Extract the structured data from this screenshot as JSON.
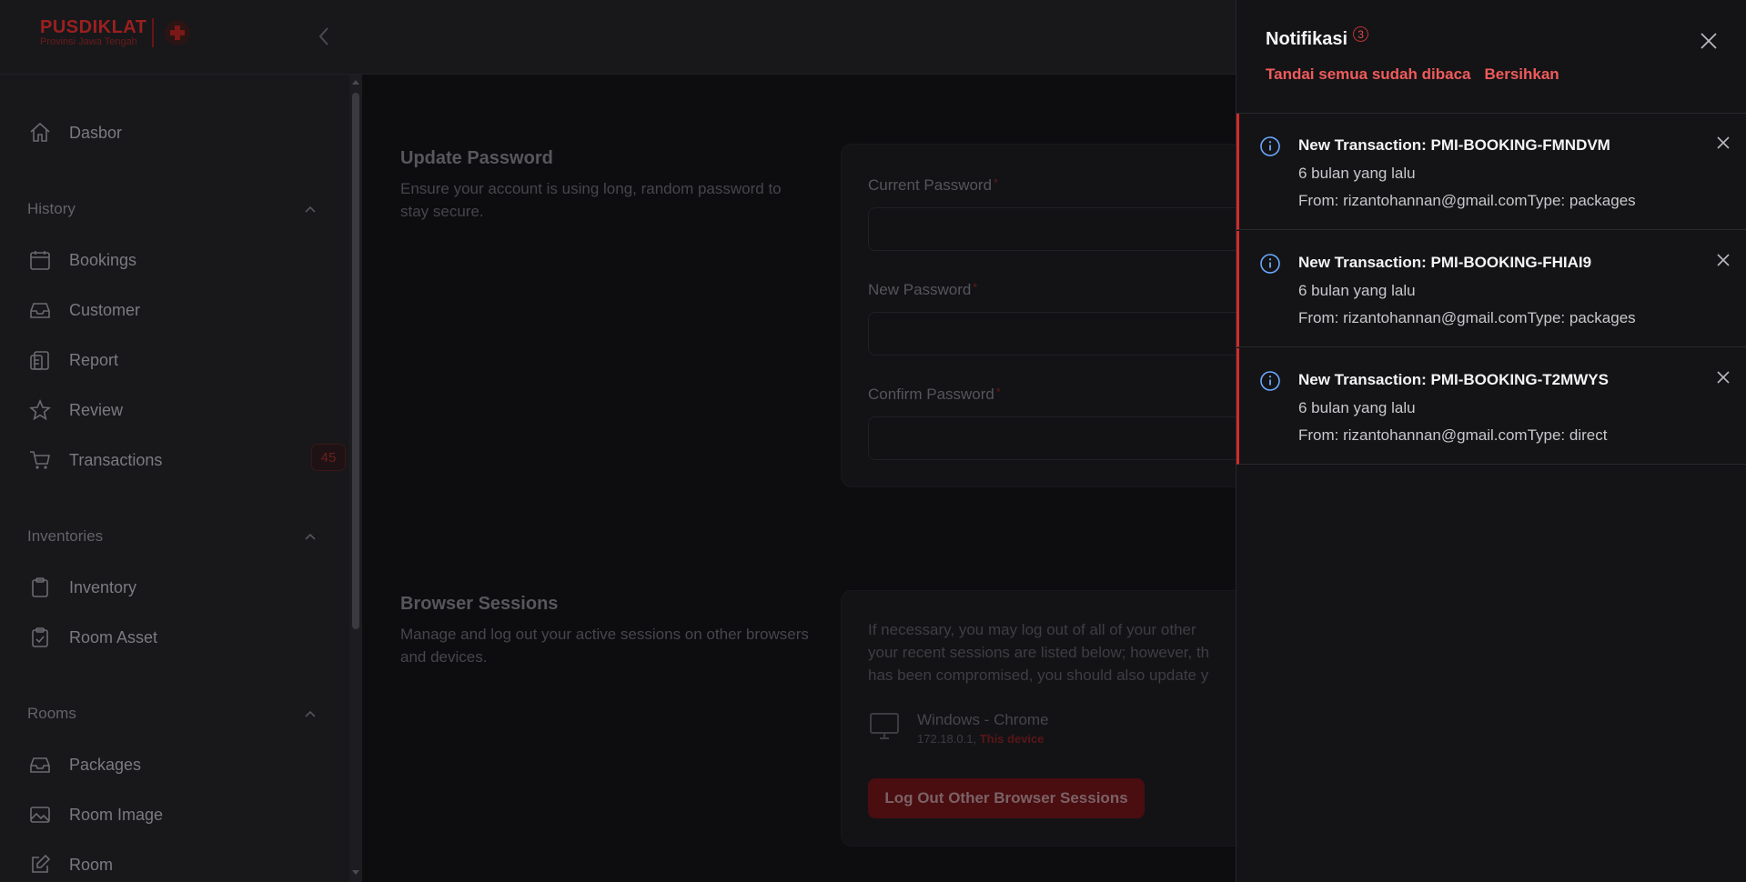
{
  "brand": {
    "title": "PUSDIKLAT",
    "subtitle": "Provinsi Jawa Tengah"
  },
  "sidebar": {
    "items": [
      {
        "label": "Dasbor",
        "icon": "home-icon"
      }
    ],
    "groups": [
      {
        "label": "History",
        "items": [
          {
            "label": "Bookings",
            "icon": "calendar-icon"
          },
          {
            "label": "Customer",
            "icon": "inbox-icon"
          },
          {
            "label": "Report",
            "icon": "clipboard-copy-icon"
          },
          {
            "label": "Review",
            "icon": "star-icon"
          },
          {
            "label": "Transactions",
            "icon": "cart-icon",
            "badge": "45"
          }
        ]
      },
      {
        "label": "Inventories",
        "items": [
          {
            "label": "Inventory",
            "icon": "clipboard-icon"
          },
          {
            "label": "Room Asset",
            "icon": "clipboard-check-icon"
          }
        ]
      },
      {
        "label": "Rooms",
        "items": [
          {
            "label": "Packages",
            "icon": "inbox-icon"
          },
          {
            "label": "Room Image",
            "icon": "image-icon"
          },
          {
            "label": "Room",
            "icon": "pencil-square-icon"
          }
        ]
      }
    ]
  },
  "update_password": {
    "title": "Update Password",
    "description": "Ensure your account is using long, random password to stay secure.",
    "fields": [
      {
        "label": "Current Password",
        "required": "*"
      },
      {
        "label": "New Password",
        "required": "*"
      },
      {
        "label": "Confirm Password",
        "required": "*"
      }
    ]
  },
  "browser_sessions": {
    "title": "Browser Sessions",
    "description": "Manage and log out your active sessions on other browsers and devices.",
    "notice_lines": [
      "If necessary, you may log out of all of your other",
      "your recent sessions are listed below; however, th",
      "has been compromised, you should also update y"
    ],
    "device": {
      "name": "Windows - Chrome",
      "ip": "172.18.0.1,",
      "this_device": "This device"
    },
    "logout_button": "Log Out Other Browser Sessions"
  },
  "notifications": {
    "title": "Notifikasi",
    "count": "3",
    "mark_all_read": "Tandai semua sudah dibaca",
    "clear": "Bersihkan",
    "items": [
      {
        "title": "New Transaction: PMI-BOOKING-FMNDVM",
        "time": "6 bulan yang lalu",
        "body": "From: rizantohannan@gmail.comType: packages"
      },
      {
        "title": "New Transaction: PMI-BOOKING-FHIAI9",
        "time": "6 bulan yang lalu",
        "body": "From: rizantohannan@gmail.comType: packages"
      },
      {
        "title": "New Transaction: PMI-BOOKING-T2MWYS",
        "time": "6 bulan yang lalu",
        "body": "From: rizantohannan@gmail.comType: direct"
      }
    ]
  },
  "colors": {
    "accent": "#ef5b5b",
    "notif_border": "#d42a2a",
    "panel_bg": "#141416"
  }
}
